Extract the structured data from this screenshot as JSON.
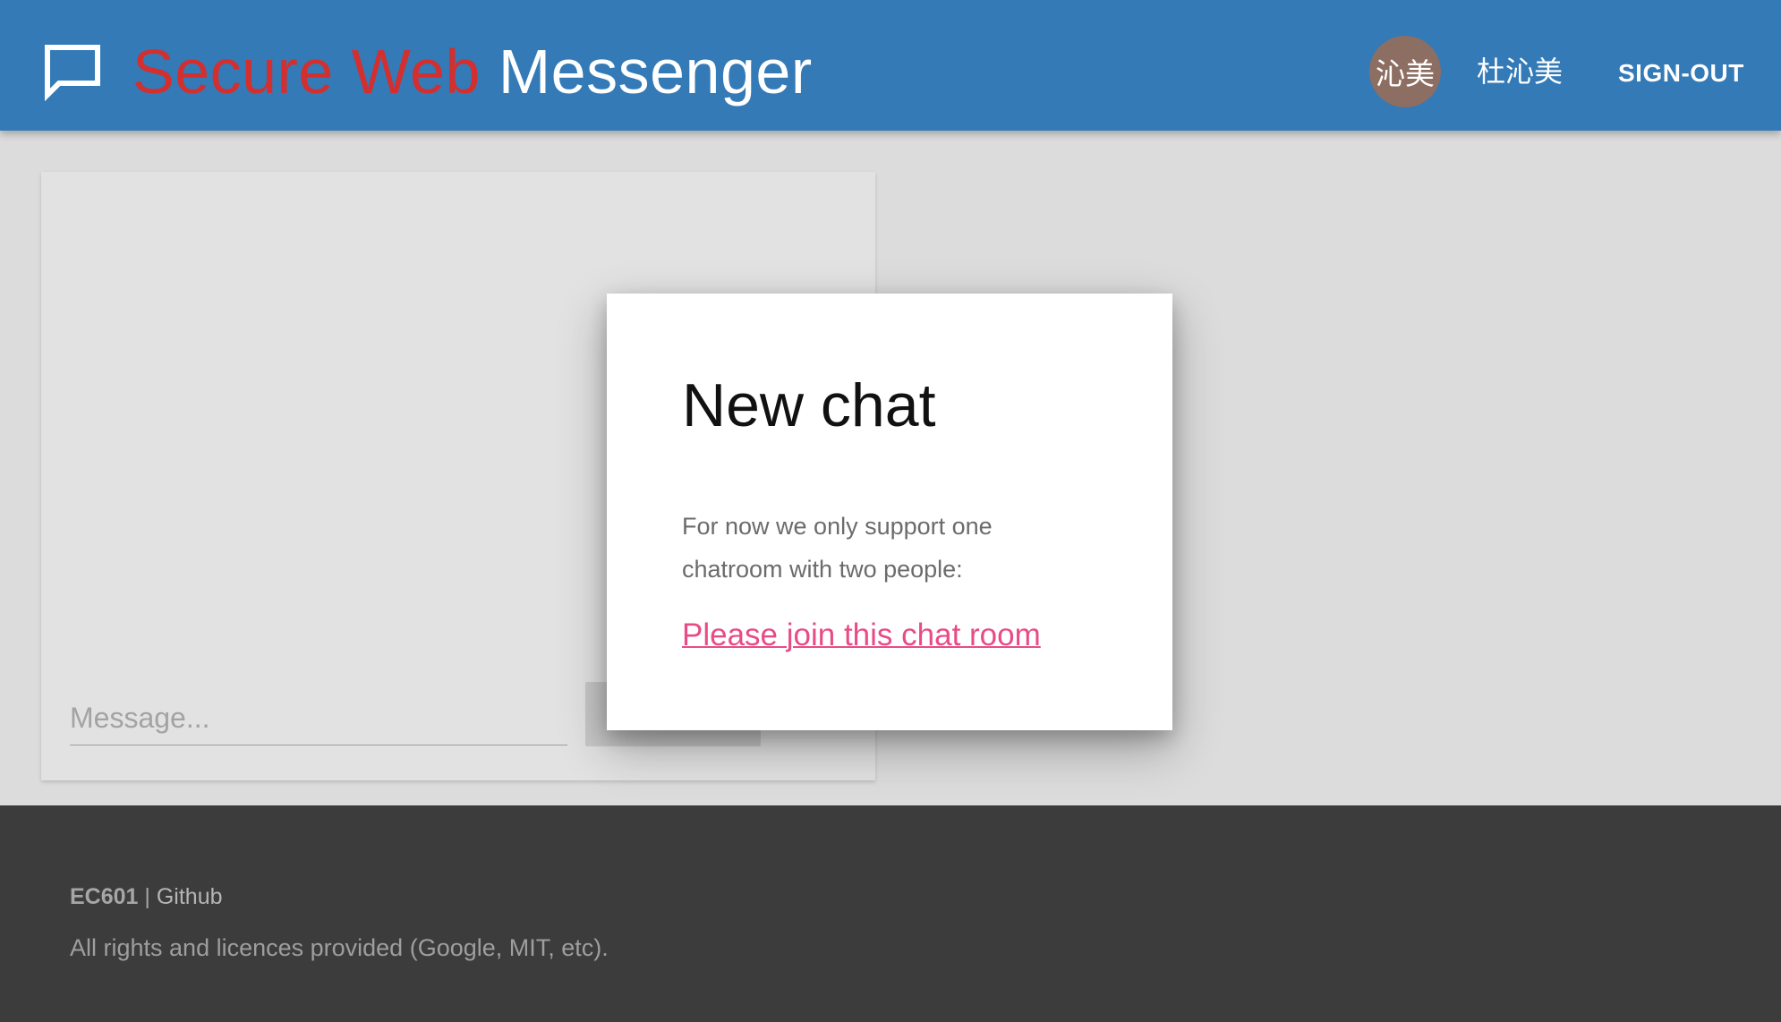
{
  "header": {
    "title_accent": "Secure Web",
    "title_rest": " Messenger",
    "avatar_text": "沁美",
    "username": "杜沁美",
    "signout_label": "SIGN-OUT",
    "accent_color": "#d32f2f",
    "bar_color": "#337ab7",
    "icon": "chat-bubble-icon"
  },
  "chat": {
    "message_placeholder": "Message..."
  },
  "dialog": {
    "title": "New chat",
    "text": "For now we only support one chatroom with two people:",
    "link_label": "Please join this chat room",
    "link_color": "#e84c86"
  },
  "footer": {
    "course": "EC601",
    "separator": " | ",
    "github_label": "Github",
    "rights": "All rights and licences provided (Google, MIT, etc)."
  }
}
